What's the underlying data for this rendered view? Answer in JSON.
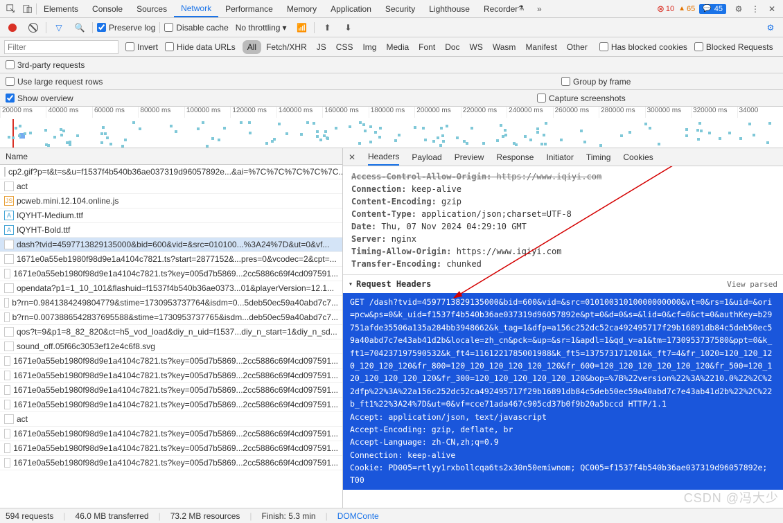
{
  "mainTabs": [
    "Elements",
    "Console",
    "Sources",
    "Network",
    "Performance",
    "Memory",
    "Application",
    "Security",
    "Lighthouse",
    "Recorder"
  ],
  "mainActive": "Network",
  "badges": {
    "errors": "10",
    "warnings": "65",
    "messages": "45"
  },
  "subToolbar": {
    "preserveLog": "Preserve log",
    "disableCache": "Disable cache",
    "throttling": "No throttling"
  },
  "filterBar": {
    "placeholder": "Filter",
    "invert": "Invert",
    "hideDataUrls": "Hide data URLs",
    "types": [
      "All",
      "Fetch/XHR",
      "JS",
      "CSS",
      "Img",
      "Media",
      "Font",
      "Doc",
      "WS",
      "Wasm",
      "Manifest",
      "Other"
    ],
    "activeType": "All",
    "hasBlockedCookies": "Has blocked cookies",
    "blockedRequests": "Blocked Requests"
  },
  "optRow1": {
    "thirdParty": "3rd-party requests"
  },
  "optRow2": {
    "largeRows": "Use large request rows",
    "groupByFrame": "Group by frame"
  },
  "optRow3": {
    "showOverview": "Show overview",
    "captureScreenshots": "Capture screenshots"
  },
  "timelineTicks": [
    "20000 ms",
    "40000 ms",
    "60000 ms",
    "80000 ms",
    "100000 ms",
    "120000 ms",
    "140000 ms",
    "160000 ms",
    "180000 ms",
    "200000 ms",
    "220000 ms",
    "240000 ms",
    "260000 ms",
    "280000 ms",
    "300000 ms",
    "320000 ms",
    "34000"
  ],
  "listHeader": "Name",
  "requests": [
    {
      "ico": "none",
      "name": "cp2.gif?p=t&t=s&u=f1537f4b540b36ae037319d96057892e...&ai=%7C%7C%7C%7C%7C..."
    },
    {
      "ico": "none",
      "name": "act"
    },
    {
      "ico": "js",
      "name": "pcweb.mini.12.104.online.js"
    },
    {
      "ico": "font",
      "name": "IQYHT-Medium.ttf"
    },
    {
      "ico": "font",
      "name": "IQYHT-Bold.ttf"
    },
    {
      "ico": "none",
      "name": "dash?tvid=4597713829135000&bid=600&vid=&src=010100...%3A24%7D&ut=0&vf...",
      "sel": true
    },
    {
      "ico": "none",
      "name": "1671e0a55eb1980f98d9e1a4104c7821.ts?start=2877152&...pres=0&vcodec=2&cpt=..."
    },
    {
      "ico": "none",
      "name": "1671e0a55eb1980f98d9e1a4104c7821.ts?key=005d7b5869...2cc5886c69f4cd097591..."
    },
    {
      "ico": "none",
      "name": "opendata?p1=1_10_101&flashuid=f1537f4b540b36ae0373...01&playerVersion=12.1..."
    },
    {
      "ico": "none",
      "name": "b?rn=0.9841384249804779&stime=1730953737764&isdm=0...5deb50ec59a40abd7c7..."
    },
    {
      "ico": "none",
      "name": "b?rn=0.0073886542837695588&stime=1730953737765&isdm...deb50ec59a40abd7c7..."
    },
    {
      "ico": "none",
      "name": "qos?t=9&p1=8_82_820&ct=h5_vod_load&diy_n_uid=f1537...diy_n_start=1&diy_n_sd..."
    },
    {
      "ico": "none",
      "name": "sound_off.05f66c3053ef12e4c6f8.svg"
    },
    {
      "ico": "none",
      "name": "1671e0a55eb1980f98d9e1a4104c7821.ts?key=005d7b5869...2cc5886c69f4cd097591..."
    },
    {
      "ico": "none",
      "name": "1671e0a55eb1980f98d9e1a4104c7821.ts?key=005d7b5869...2cc5886c69f4cd097591..."
    },
    {
      "ico": "none",
      "name": "1671e0a55eb1980f98d9e1a4104c7821.ts?key=005d7b5869...2cc5886c69f4cd097591..."
    },
    {
      "ico": "none",
      "name": "1671e0a55eb1980f98d9e1a4104c7821.ts?key=005d7b5869...2cc5886c69f4cd097591..."
    },
    {
      "ico": "none",
      "name": "act"
    },
    {
      "ico": "none",
      "name": "1671e0a55eb1980f98d9e1a4104c7821.ts?key=005d7b5869...2cc5886c69f4cd097591..."
    },
    {
      "ico": "none",
      "name": "1671e0a55eb1980f98d9e1a4104c7821.ts?key=005d7b5869...2cc5886c69f4cd097591..."
    },
    {
      "ico": "none",
      "name": "1671e0a55eb1980f98d9e1a4104c7821.ts?key=005d7b5869...2cc5886c69f4cd097591..."
    }
  ],
  "detailTabs": [
    "Headers",
    "Payload",
    "Preview",
    "Response",
    "Initiator",
    "Timing",
    "Cookies"
  ],
  "detailActive": "Headers",
  "responseHeaders": [
    {
      "k": "Access-Control-Allow-Origin:",
      "v": "https://www.iqiyi.com"
    },
    {
      "k": "Connection:",
      "v": "keep-alive"
    },
    {
      "k": "Content-Encoding:",
      "v": "gzip"
    },
    {
      "k": "Content-Type:",
      "v": "application/json;charset=UTF-8"
    },
    {
      "k": "Date:",
      "v": "Thu, 07 Nov 2024 04:29:10 GMT"
    },
    {
      "k": "Server:",
      "v": "nginx"
    },
    {
      "k": "Timing-Allow-Origin:",
      "v": "https://www.iqiyi.com"
    },
    {
      "k": "Transfer-Encoding:",
      "v": "chunked"
    }
  ],
  "requestHeadersTitle": "Request Headers",
  "viewParsed": "View parsed",
  "rawRequest": "GET /dash?tvid=4597713829135000&bid=600&vid=&src=01010031010000000000&vt=0&rs=1&uid=&ori=pcw&ps=0&k_uid=f1537f4b540b36ae037319d96057892e&pt=0&d=0&s=&lid=0&cf=0&ct=0&authKey=b29751afde35506a135a284bb3948662&k_tag=1&dfp=a156c252dc52ca492495717f29b16891db84c5deb50ec59a40abd7c7e43ab41d2b&locale=zh_cn&pck=&up=&sr=1&apdl=1&qd_v=a1&tm=1730953737580&ppt=0&k_ft1=704237197590532&k_ft4=1161221785001988&k_ft5=137573171201&k_ft7=4&fr_1020=120_120_120_120_120_120&fr_800=120_120_120_120_120_120&fr_600=120_120_120_120_120_120&fr_500=120_120_120_120_120_120&fr_300=120_120_120_120_120_120&bop=%7B%22version%22%3A%2210.0%22%2C%22dfp%22%3A%22a156c252dc52ca492495717f29b16891db84c5deb50ec59a40abd7c7e43ab41d2b%22%2C%22b_ft1%22%3A24%7D&ut=0&vf=cce71ada467c905cd37b0f9b20a5bccd HTTP/1.1\nAccept: application/json, text/javascript\nAccept-Encoding: gzip, deflate, br\nAccept-Language: zh-CN,zh;q=0.9\nConnection: keep-alive\nCookie: PD005=rtlyy1rxbollcqa6ts2x30n50emiwnom; QC005=f1537f4b540b36ae037319d96057892e;  T00",
  "statusBar": {
    "requests": "594 requests",
    "transferred": "46.0 MB transferred",
    "resources": "73.2 MB resources",
    "finish": "Finish: 5.3 min",
    "dom": "DOMConte"
  },
  "watermark": "CSDN @冯大少"
}
